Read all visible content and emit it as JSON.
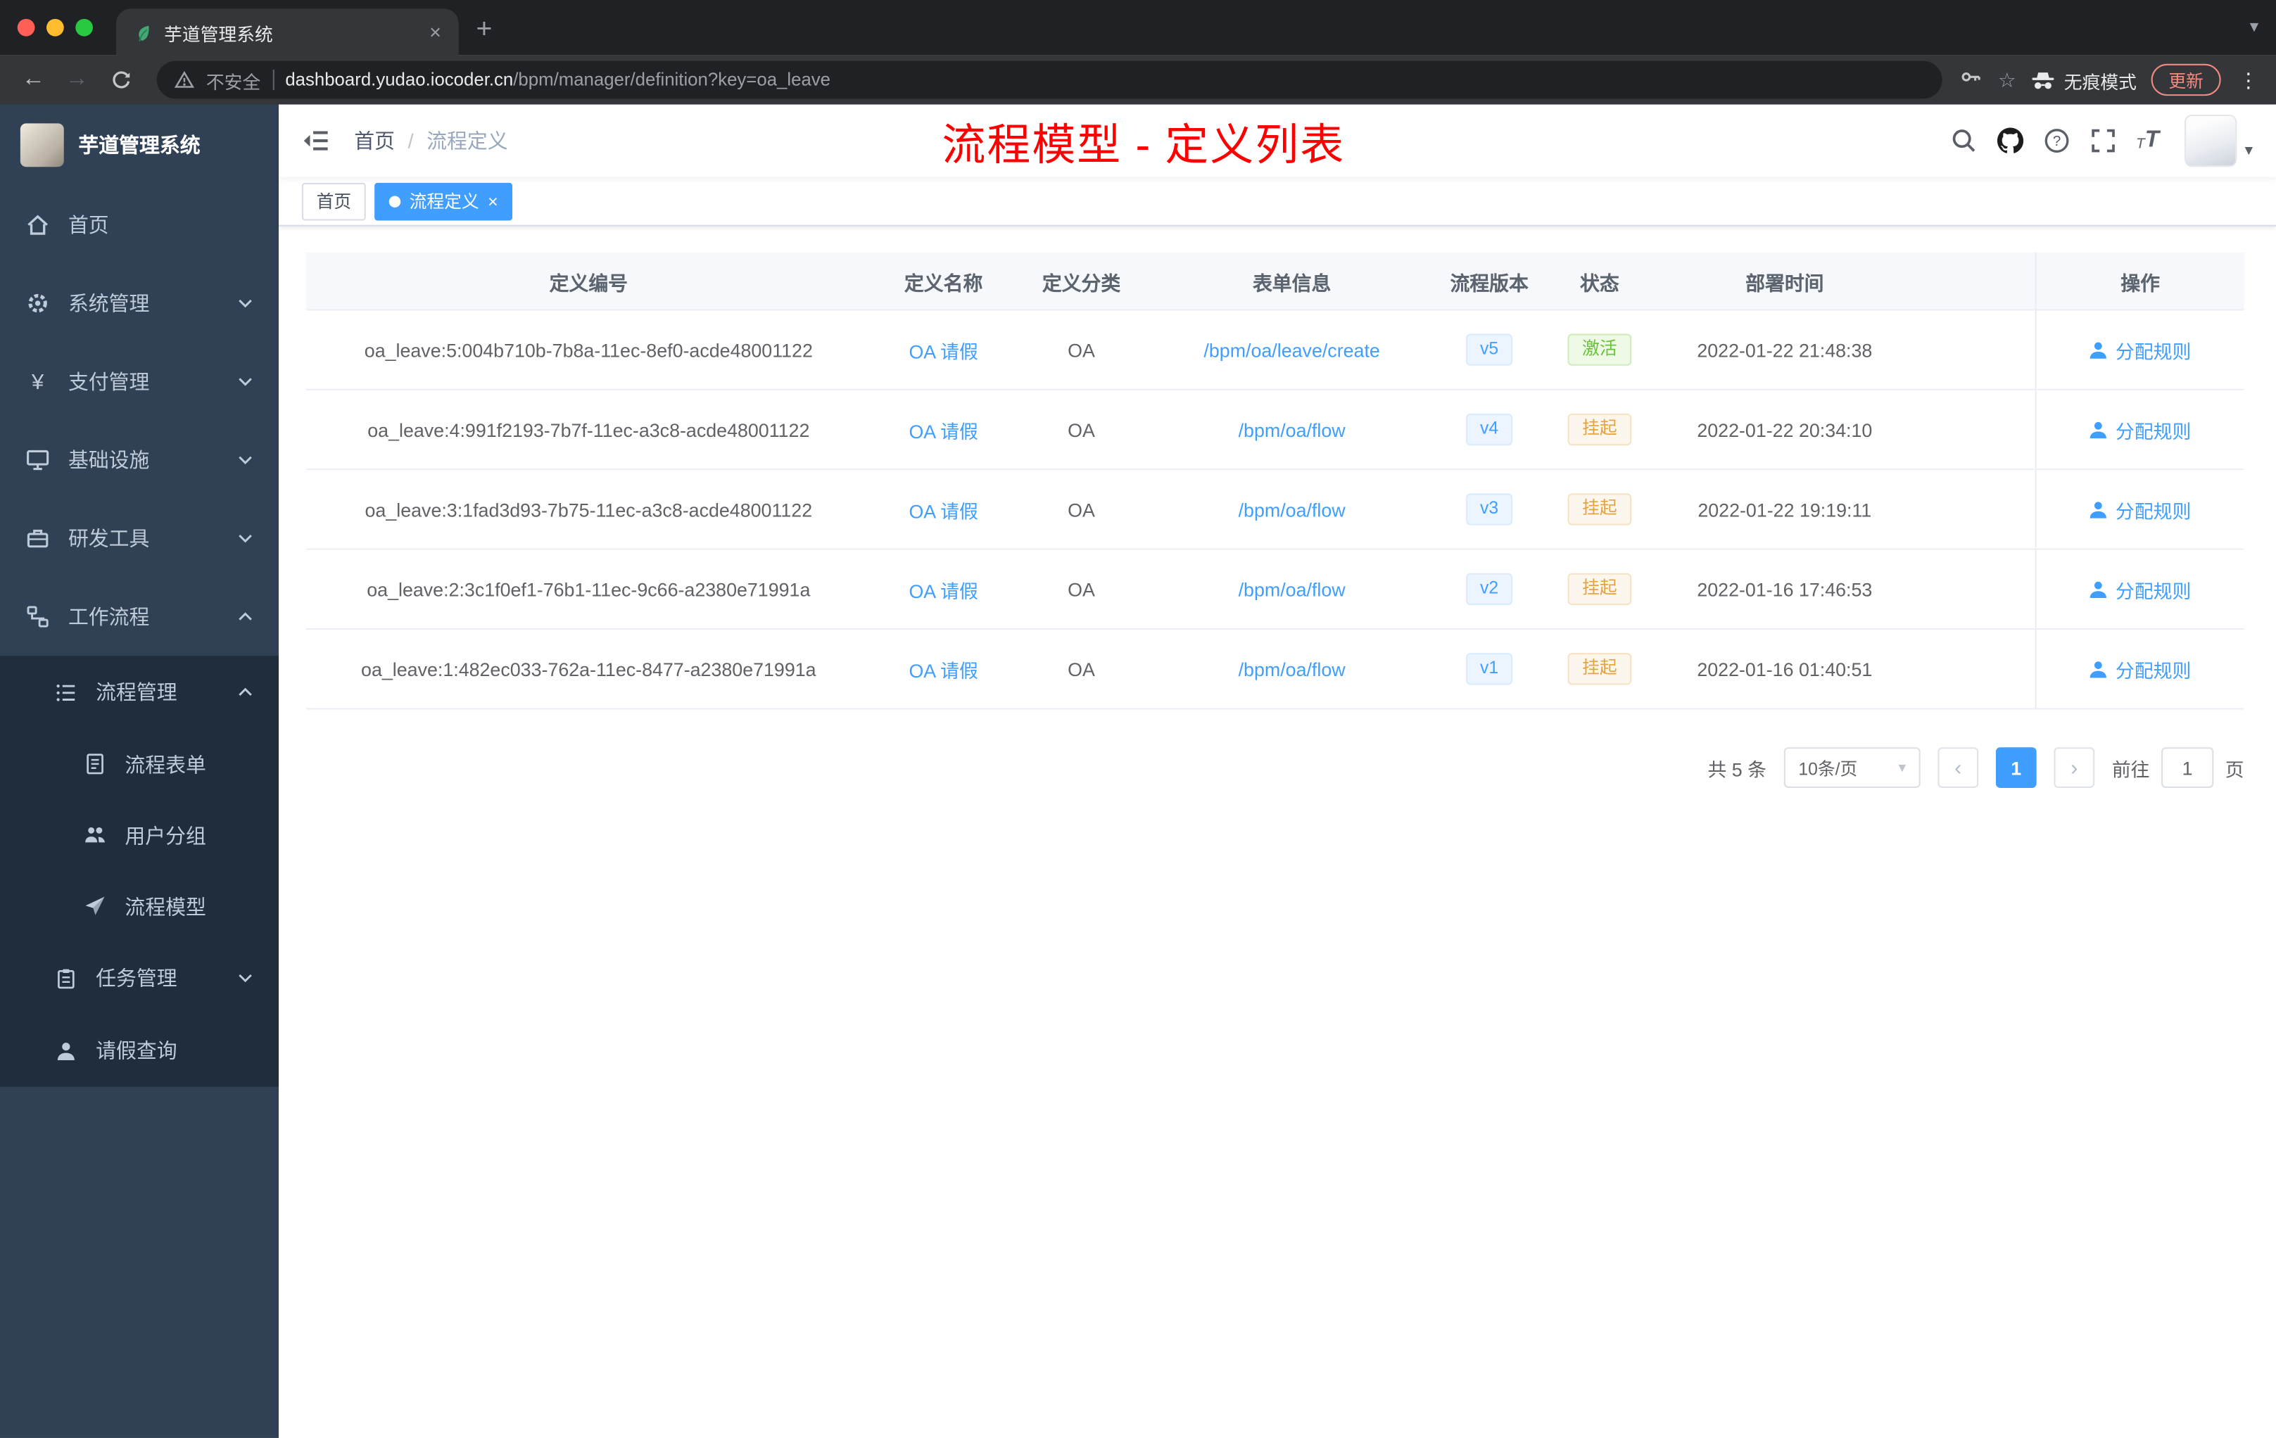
{
  "browser": {
    "tab_title": "芋道管理系统",
    "security_label": "不安全",
    "url_domain": "dashboard.yudao.iocoder.cn",
    "url_path": "/bpm/manager/definition?key=oa_leave",
    "incognito_label": "无痕模式",
    "update_label": "更新"
  },
  "glyphs": {
    "back": "←",
    "forward": "→",
    "plus": "+",
    "close": "×",
    "menu_dots": "⋮",
    "star": "☆",
    "caret_down": "▾",
    "prev": "‹",
    "next": "›",
    "sep": "/",
    "yen": "¥",
    "size_small": "T",
    "size_big": "T"
  },
  "sidebar": {
    "logo_title": "芋道管理系统",
    "items": [
      {
        "label": "首页"
      },
      {
        "label": "系统管理"
      },
      {
        "label": "支付管理"
      },
      {
        "label": "基础设施"
      },
      {
        "label": "研发工具"
      },
      {
        "label": "工作流程"
      }
    ],
    "submenu": {
      "group_label": "流程管理",
      "children": [
        {
          "label": "流程表单"
        },
        {
          "label": "用户分组"
        },
        {
          "label": "流程模型"
        }
      ],
      "task_label": "任务管理",
      "leave_label": "请假查询"
    }
  },
  "navbar": {
    "breadcrumb_home": "首页",
    "breadcrumb_current": "流程定义",
    "annotation": "流程模型 - 定义列表"
  },
  "tags": {
    "home": "首页",
    "active": "流程定义"
  },
  "table": {
    "columns": [
      "定义编号",
      "定义名称",
      "定义分类",
      "表单信息",
      "流程版本",
      "状态",
      "部署时间",
      "操作"
    ],
    "rows": [
      {
        "id": "oa_leave:5:004b710b-7b8a-11ec-8ef0-acde48001122",
        "name": "OA 请假",
        "category": "OA",
        "form": "/bpm/oa/leave/create",
        "version": "v5",
        "status": "激活",
        "status_type": "success",
        "time": "2022-01-22 21:48:38",
        "action": "分配规则"
      },
      {
        "id": "oa_leave:4:991f2193-7b7f-11ec-a3c8-acde48001122",
        "name": "OA 请假",
        "category": "OA",
        "form": "/bpm/oa/flow",
        "version": "v4",
        "status": "挂起",
        "status_type": "warning",
        "time": "2022-01-22 20:34:10",
        "action": "分配规则"
      },
      {
        "id": "oa_leave:3:1fad3d93-7b75-11ec-a3c8-acde48001122",
        "name": "OA 请假",
        "category": "OA",
        "form": "/bpm/oa/flow",
        "version": "v3",
        "status": "挂起",
        "status_type": "warning",
        "time": "2022-01-22 19:19:11",
        "action": "分配规则"
      },
      {
        "id": "oa_leave:2:3c1f0ef1-76b1-11ec-9c66-a2380e71991a",
        "name": "OA 请假",
        "category": "OA",
        "form": "/bpm/oa/flow",
        "version": "v2",
        "status": "挂起",
        "status_type": "warning",
        "time": "2022-01-16 17:46:53",
        "action": "分配规则"
      },
      {
        "id": "oa_leave:1:482ec033-762a-11ec-8477-a2380e71991a",
        "name": "OA 请假",
        "category": "OA",
        "form": "/bpm/oa/flow",
        "version": "v1",
        "status": "挂起",
        "status_type": "warning",
        "time": "2022-01-16 01:40:51",
        "action": "分配规则"
      }
    ]
  },
  "pagination": {
    "total": "共 5 条",
    "page_size": "10条/页",
    "page": "1",
    "goto": "前往",
    "goto_value": "1",
    "unit": "页"
  },
  "colors": {
    "accent": "#409eff",
    "success": "#67c23a",
    "warning": "#e6a23c",
    "annotation_red": "#fd0000",
    "sidebar_bg": "#304156",
    "submenu_bg": "#1f2d3d",
    "chrome_bg": "#202124",
    "toolbar_bg": "#35363a"
  }
}
